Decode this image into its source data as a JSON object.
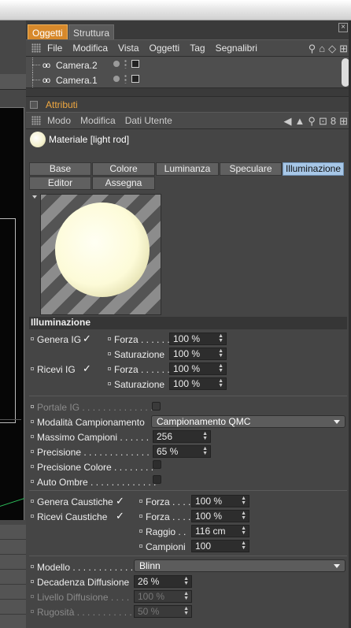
{
  "objects_panel": {
    "tabs": [
      "Oggetti",
      "Struttura"
    ],
    "menu": [
      "File",
      "Modifica",
      "Vista",
      "Oggetti",
      "Tag",
      "Segnalibri"
    ],
    "items": [
      "Camera.2",
      "Camera.1"
    ]
  },
  "attributes_panel": {
    "title": "Attributi",
    "menu": [
      "Modo",
      "Modifica",
      "Dati Utente"
    ],
    "material_name": "Materiale [light rod]",
    "tabs_row1": [
      "Base",
      "Colore",
      "Luminanza",
      "Speculare",
      "Illuminazione"
    ],
    "tabs_row2": [
      "Editor",
      "Assegna"
    ],
    "selected_tab": "Illuminazione"
  },
  "illum": {
    "section": "Illuminazione",
    "genera_ig": "Genera IG",
    "ricevi_ig": "Ricevi IG",
    "forza": "Forza . . . . . .",
    "saturazione": "Saturazione",
    "forza_gen_val": "100 %",
    "sat_gen_val": "100 %",
    "forza_ric_val": "100 %",
    "sat_ric_val": "100 %",
    "portale_ig": "Portale IG . . . . . . . . . . . . . . .",
    "modalita": "Modalità Campionamento",
    "modalita_val": "Campionamento QMC",
    "massimo": "Massimo Campioni . . . . . .",
    "massimo_val": "256",
    "precisione": "Precisione . . . . . . . . . . . . .",
    "precisione_val": "65 %",
    "precisione_colore": "Precisione Colore . . . . . . . .",
    "auto_ombre": "Auto Ombre . . . . . . . . . . . . .",
    "genera_caustiche": "Genera Caustiche",
    "ricevi_caustiche": "Ricevi Caustiche",
    "forza_c": "Forza . . . .",
    "forza_c_val": "100 %",
    "forza_c2": "Forza . . . .",
    "forza_c2_val": "100 %",
    "raggio": "Raggio . .",
    "raggio_val": "116 cm",
    "campioni": "Campioni",
    "campioni_val": "100",
    "modello": "Modello . . . . . . . . . . . .",
    "modello_val": "Blinn",
    "decadenza": "Decadenza Diffusione",
    "decadenza_val": "26 %",
    "livello": "Livello Diffusione . . . .",
    "livello_val": "100 %",
    "rugosita": "Rugosità . . . . . . . . . . . .",
    "rugosita_val": "50 %"
  }
}
